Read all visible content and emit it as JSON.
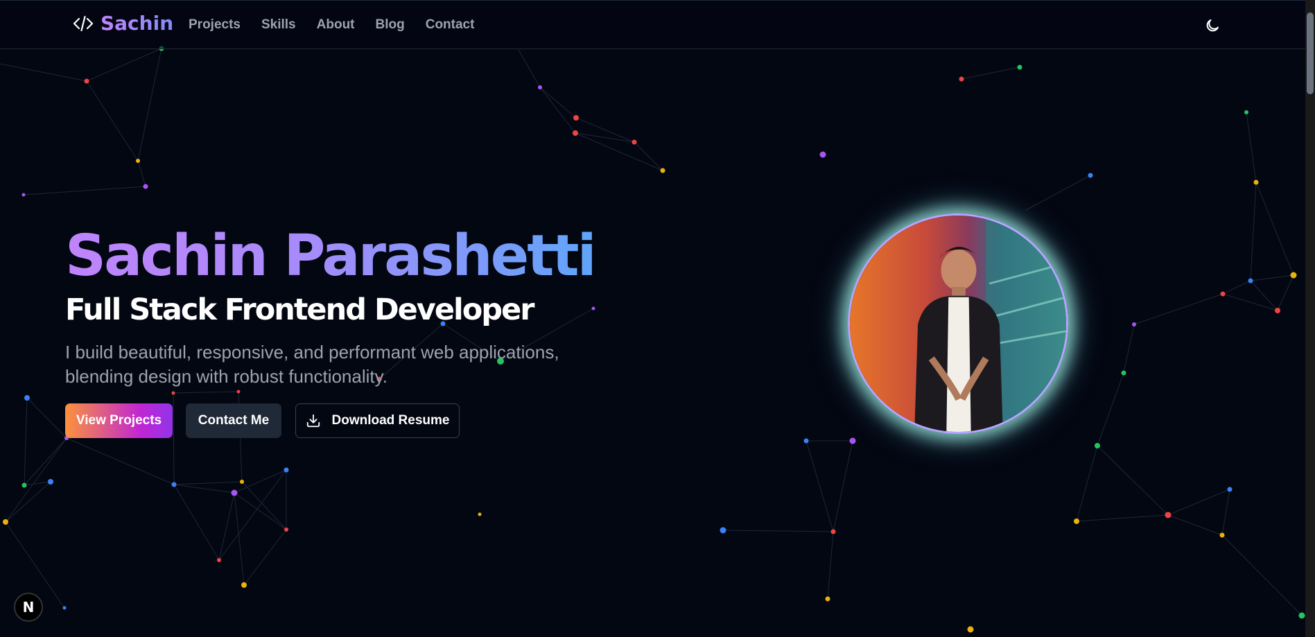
{
  "nav": {
    "brand": "Sachin",
    "brand_icon": "code-icon",
    "links": [
      "Projects",
      "Skills",
      "About",
      "Blog",
      "Contact"
    ],
    "theme_icon": "moon-icon"
  },
  "hero": {
    "name": "Sachin Parashetti",
    "role": "Full Stack Frontend Developer",
    "description": "I build beautiful, responsive, and performant web applications, blending design with robust functionality.",
    "buttons": {
      "view_projects": "View Projects",
      "contact_me": "Contact Me",
      "download_resume": "Download Resume"
    },
    "download_icon": "download-icon",
    "avatar": "profile-photo"
  },
  "badge": {
    "label": "N",
    "icon": "nextjs-icon"
  },
  "colors": {
    "background": "#030712",
    "particle_red": "#ef4444",
    "particle_green": "#22c55e",
    "particle_blue": "#3b82f6",
    "particle_yellow": "#eab308",
    "particle_purple": "#a855f7",
    "accent_gradient_start": "#c084fc",
    "accent_gradient_end": "#60a5fa"
  }
}
